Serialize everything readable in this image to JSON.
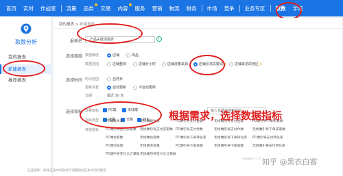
{
  "topnav": {
    "items": [
      {
        "label": "首页"
      },
      {
        "label": "实时"
      },
      {
        "label": "作战室"
      },
      {
        "label": "流量"
      },
      {
        "label": "品类"
      },
      {
        "label": "交易"
      },
      {
        "label": "内容"
      },
      {
        "label": "服务"
      },
      {
        "label": "营销"
      },
      {
        "label": "物流"
      },
      {
        "label": "财务"
      },
      {
        "label": "市场"
      },
      {
        "label": "竞争"
      },
      {
        "label": "业务专区"
      },
      {
        "label": "取数"
      },
      {
        "label": "学院"
      }
    ],
    "background": "#1b74e4"
  },
  "sidebar": {
    "title": "取数分析",
    "items": [
      {
        "label": "我的报表"
      },
      {
        "label": "新建报表"
      },
      {
        "label": "推荐报表"
      }
    ]
  },
  "breadcrumb": {
    "root": "我的报表",
    "separator": ">",
    "current": "新建报表"
  },
  "form": {
    "report_name": {
      "label": "报表名",
      "value": "产品关键词报表"
    },
    "dimension": {
      "label": "选择维度",
      "sub_object": "数据维度",
      "objects": [
        {
          "label": "店铺",
          "checked": true
        },
        {
          "label": "商品",
          "checked": false
        }
      ],
      "sub_range": "数据范围",
      "ranges": [
        {
          "label": "店铺整体",
          "checked": false
        },
        {
          "label": "店铺分小时",
          "checked": false
        },
        {
          "label": "店铺流量来源",
          "checked": false
        },
        {
          "label": "店铺引流关键词",
          "checked": true
        },
        {
          "label": "店铺来访的地区",
          "checked": false
        }
      ]
    },
    "time": {
      "label": "选择时间",
      "sub_period": "时间范围",
      "period": "自然日",
      "sub_update": "更新设置",
      "updates": [
        {
          "label": "自动更新",
          "checked": true
        },
        {
          "label": "不自动更新",
          "checked": false
        }
      ],
      "sub_recent": "日期",
      "recent": "最近 30 天"
    },
    "metrics": {
      "label": "选择指标",
      "sub_traffic": "流量指标",
      "traffic": [
        {
          "label": "PC端",
          "checked": true
        },
        {
          "label": "无线端",
          "checked": true
        }
      ],
      "sub_type": "指标类型",
      "types": [
        {
          "label": "流量",
          "checked": true
        },
        {
          "label": "交易",
          "checked": true
        },
        {
          "label": "转化",
          "checked": true
        }
      ],
      "sub_list": "待选指标",
      "search_placeholder": "输入关键字搜索指标",
      "items": [
        [
          "PC端跳失率",
          "无线端跳失率",
          "PC端引导支付金额",
          "无线端引导支付金额",
          "PC端引导下单买家数"
        ],
        [
          "PC端引导支付买家数",
          "无线端引导支付买家数",
          "PC端引导支付件数",
          "无线端引导支付件数",
          "无线端引导下单买家数"
        ],
        [
          "PC端访客数",
          "无线端访客数",
          "PC端引导下单转化率",
          "无线端引导下单转化率",
          "PC端引导支付转化率"
        ],
        [
          "PC端浏览量",
          "无线端浏览量",
          "PC端引导下单金额",
          "无线端引导下单金额",
          "无线端引导支付转化率"
        ],
        [
          "PC端引导支付父订单数",
          "无线端引导支付父订单数",
          "",
          "",
          ""
        ]
      ],
      "hint": "已选指标：拖动已选中的指标可调整指标在表中的列顺序"
    }
  },
  "annotation": "根据需求，选择数据指标",
  "watermark": "知乎 @黑衣白客",
  "watermark_small": "已选指标 0 / 14",
  "accent": "#1b74e4",
  "annotation_color": "#e02020"
}
